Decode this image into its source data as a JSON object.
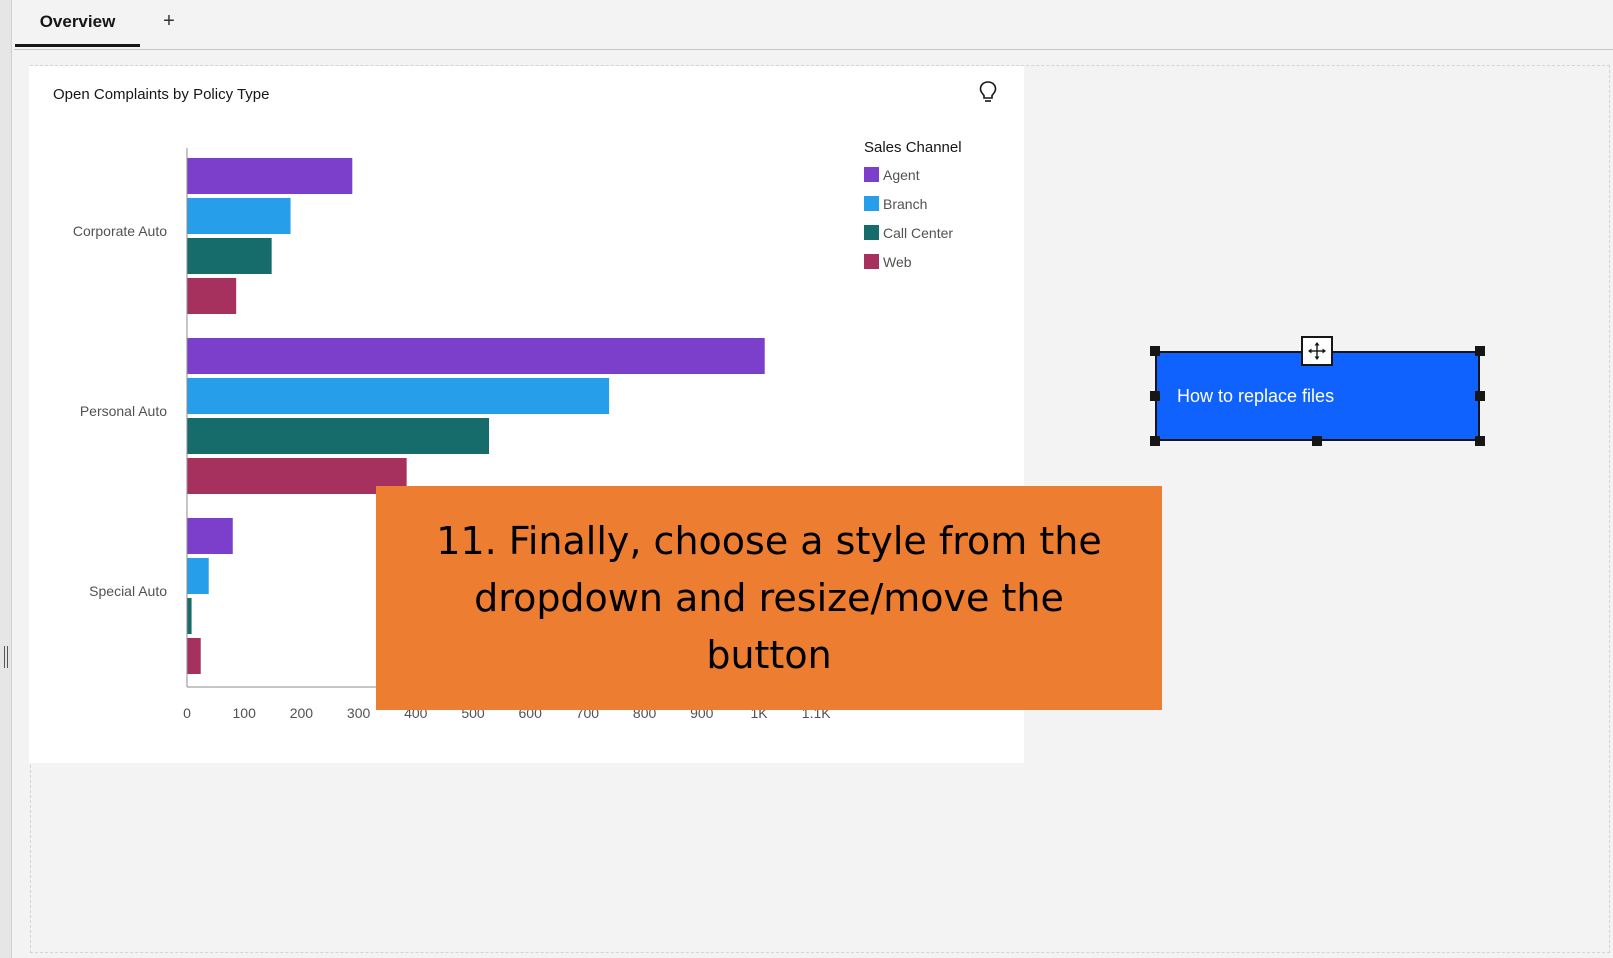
{
  "tabs": {
    "active_label": "Overview",
    "add_label": "+"
  },
  "widget": {
    "title": "Open Complaints by Policy Type",
    "insight_icon": "lightbulb-icon"
  },
  "chart_data": {
    "type": "bar",
    "orientation": "horizontal",
    "categories": [
      "Corporate Auto",
      "Personal Auto",
      "Special Auto"
    ],
    "series": [
      {
        "name": "Agent",
        "color": "#7b3fcb",
        "values": [
          289,
          1010,
          80
        ]
      },
      {
        "name": "Branch",
        "color": "#269eea",
        "values": [
          181,
          738,
          38
        ]
      },
      {
        "name": "Call Center",
        "color": "#166b6b",
        "values": [
          148,
          528,
          8
        ]
      },
      {
        "name": "Web",
        "color": "#a6305e",
        "values": [
          86,
          384,
          24
        ]
      }
    ],
    "legend_title": "Sales Channel",
    "legend_position": "top-right",
    "x_ticks": [
      "0",
      "100",
      "200",
      "300",
      "400",
      "500",
      "600",
      "700",
      "800",
      "900",
      "1K",
      "1.1K"
    ],
    "xlim": [
      0,
      1100
    ],
    "grid": false
  },
  "callout": {
    "text": "11. Finally, choose a style from the dropdown and resize/move the button"
  },
  "button_widget": {
    "label": "How to replace files",
    "color": "#0f62fe",
    "move_icon": "move-arrows-icon"
  }
}
